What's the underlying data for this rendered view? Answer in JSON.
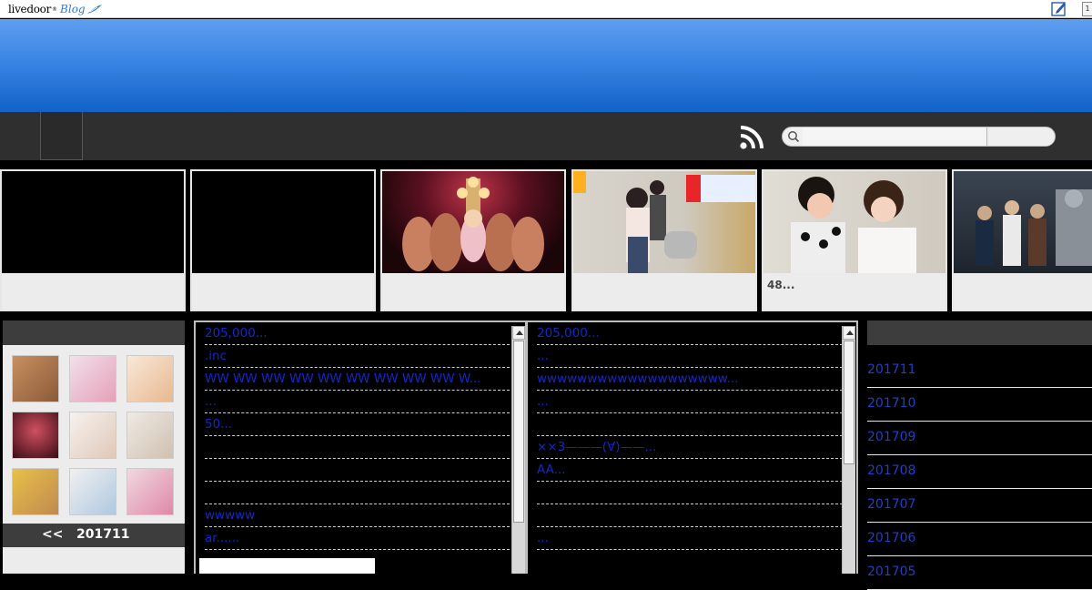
{
  "topbar": {
    "logo_text": "livedoor",
    "logo_sup": "®",
    "logo_blog": "Blog",
    "corner_label": "1"
  },
  "search": {
    "placeholder": ""
  },
  "thumbnails": [
    {
      "caption": ""
    },
    {
      "caption": ""
    },
    {
      "caption": ""
    },
    {
      "caption": ""
    },
    {
      "caption": "48..."
    },
    {
      "caption": ""
    }
  ],
  "calendar": {
    "prev_label": "<<",
    "month_label": "201711"
  },
  "comments_left": [
    "205,000...",
    ".inc",
    " WW WW WW WW WW WW WW WW WW W...",
    "...",
    "50...",
    "",
    "",
    "",
    "wwwww",
    "ar......"
  ],
  "comments_right": [
    "205,000...",
    "...",
    "wwwwwwwwwwwwwwwwwww...",
    "...",
    "",
    "××3———(∀)——...",
    "AA...",
    "",
    "",
    "..."
  ],
  "archive": [
    "201711",
    "201710",
    "201709",
    "201708",
    "201707",
    "201706",
    "201705"
  ],
  "colors": {
    "header_blue_top": "#5e9ff0",
    "header_blue_bottom": "#1262c8",
    "nav_dark": "#2f2f2f",
    "link_blue": "#1e3fc8"
  },
  "icons": {
    "rss": "rss-icon",
    "search": "search-icon",
    "edit": "edit-icon"
  }
}
